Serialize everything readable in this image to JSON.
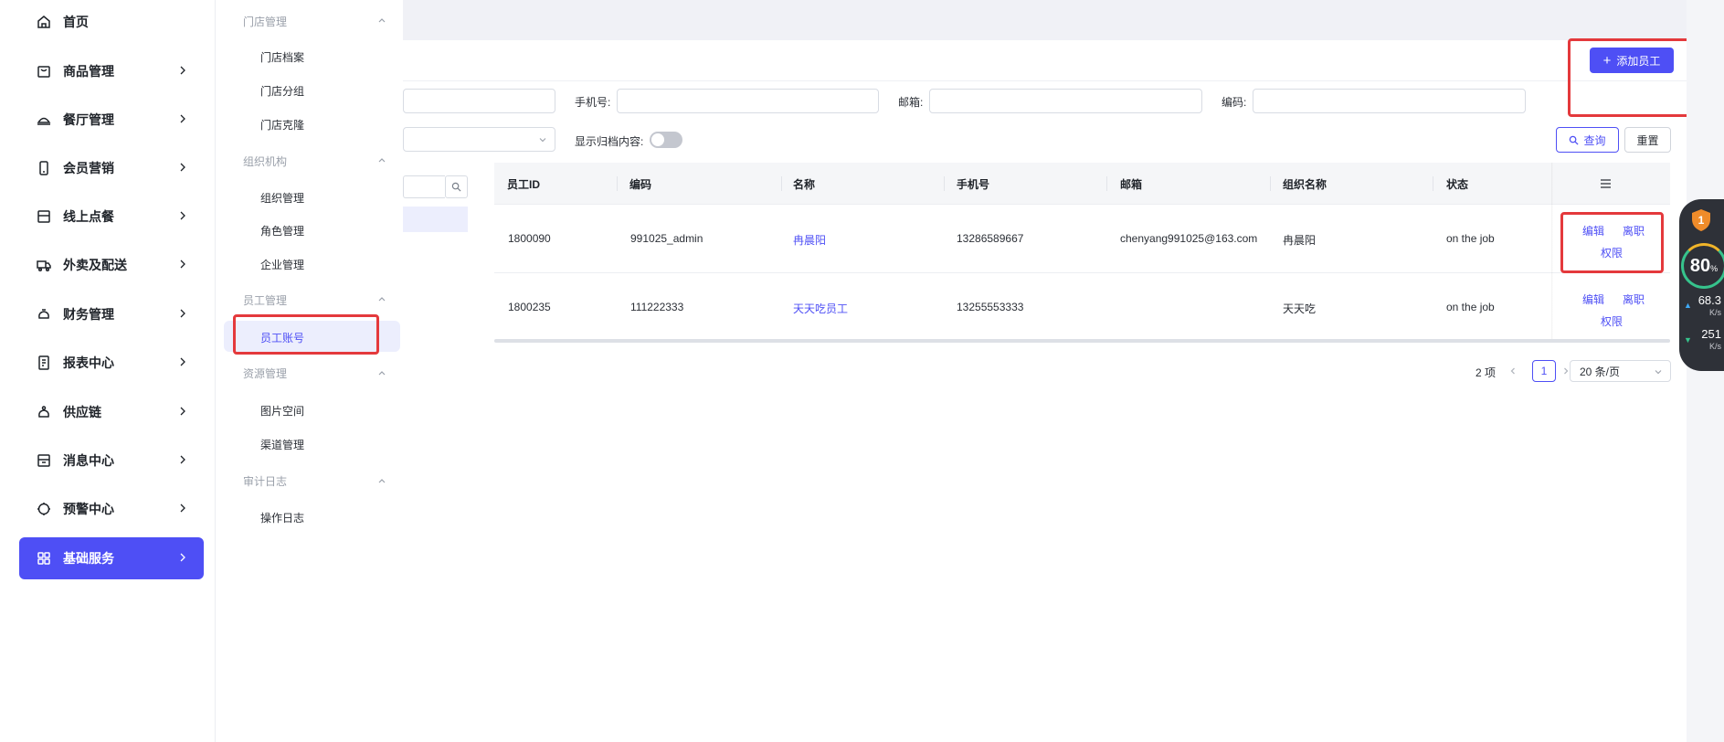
{
  "sidebar": {
    "items": [
      {
        "label": "首页",
        "icon": "home-icon",
        "has_arrow": false
      },
      {
        "label": "商品管理",
        "icon": "bag-icon",
        "has_arrow": true
      },
      {
        "label": "餐厅管理",
        "icon": "restaurant-icon",
        "has_arrow": true
      },
      {
        "label": "会员营销",
        "icon": "mobile-icon",
        "has_arrow": true
      },
      {
        "label": "线上点餐",
        "icon": "order-icon",
        "has_arrow": true
      },
      {
        "label": "外卖及配送",
        "icon": "truck-icon",
        "has_arrow": true
      },
      {
        "label": "财务管理",
        "icon": "finance-icon",
        "has_arrow": true
      },
      {
        "label": "报表中心",
        "icon": "report-icon",
        "has_arrow": true
      },
      {
        "label": "供应链",
        "icon": "supply-icon",
        "has_arrow": true
      },
      {
        "label": "消息中心",
        "icon": "message-icon",
        "has_arrow": true
      },
      {
        "label": "预警中心",
        "icon": "alert-icon",
        "has_arrow": true
      },
      {
        "label": "基础服务",
        "icon": "grid-icon",
        "has_arrow": true,
        "active": true
      }
    ],
    "active_color": "#4e4ff5"
  },
  "submenu": {
    "groups": [
      {
        "title": "门店管理",
        "items": [
          "门店档案",
          "门店分组",
          "门店克隆"
        ]
      },
      {
        "title": "组织机构",
        "items": [
          "组织管理",
          "角色管理",
          "企业管理"
        ]
      },
      {
        "title": "员工管理",
        "items": [
          "员工账号"
        ]
      },
      {
        "title": "资源管理",
        "items": [
          "图片空间",
          "渠道管理"
        ]
      },
      {
        "title": "审计日志",
        "items": [
          "操作日志"
        ]
      }
    ],
    "active_item": "员工账号"
  },
  "header": {
    "add_employee_label": "添加员工"
  },
  "filters": {
    "phone_label": "手机号:",
    "email_label": "邮箱:",
    "code_label": "编码:",
    "show_archived_label": "显示归档内容:",
    "show_archived_on": false,
    "query_label": "查询",
    "reset_label": "重置"
  },
  "table": {
    "columns": [
      "员工ID",
      "编码",
      "名称",
      "手机号",
      "邮箱",
      "组织名称",
      "状态"
    ],
    "rows": [
      {
        "id": "1800090",
        "code": "991025_admin",
        "name": "冉晨阳",
        "phone": "13286589667",
        "email": "chenyang991025@163.com",
        "org": "冉晨阳",
        "status": "on the job"
      },
      {
        "id": "1800235",
        "code": "111222333",
        "name": "天天吃员工",
        "phone": "13255553333",
        "email": "",
        "org": "天天吃",
        "status": "on the job"
      }
    ],
    "actions": {
      "edit": "编辑",
      "leave": "离职",
      "permission": "权限"
    }
  },
  "pagination": {
    "total": "2 项",
    "current_page": "1",
    "page_size": "20 条/页"
  },
  "speed_widget": {
    "badge": "1",
    "percent": "80",
    "percent_unit": "%",
    "upload": "68.3",
    "upload_unit": "K/s",
    "download": "251",
    "download_unit": "K/s"
  },
  "colors": {
    "accent": "#4e4ff5",
    "annotation_red": "#e4393c"
  }
}
